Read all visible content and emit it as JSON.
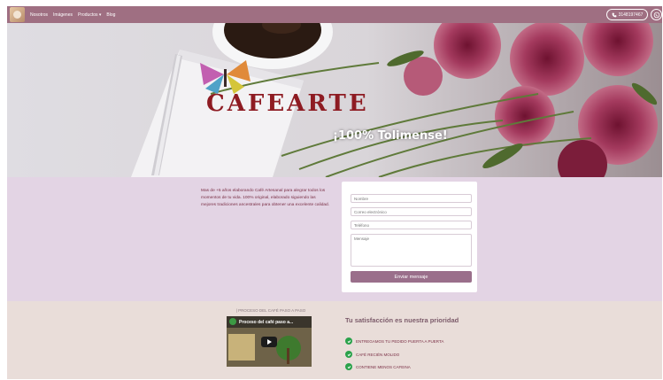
{
  "nav": {
    "links": [
      "Nosotros",
      "Imágenes",
      "Productos",
      "Blog"
    ],
    "products_caret": "▾",
    "phone": "3148197467"
  },
  "hero": {
    "brand": "CAFEARTE",
    "tagline": "¡100% Tolimense!"
  },
  "intro": {
    "text": "Mas de +5 años elaborando Café Artesanal para alegrar todos los momentos de tu vida. 100% original, elaborado siguiendo las mejores tradiciones ancestrales para obtener una excelente calidad."
  },
  "form": {
    "name_placeholder": "Nombre",
    "email_placeholder": "Correo electrónico",
    "phone_placeholder": "Teléfono",
    "message_placeholder": "Mensaje",
    "submit_label": "Enviar mensaje"
  },
  "video": {
    "heading": "| PROCESO DEL CAFÉ PASO A PASO",
    "caption": "Proceso del café paso a..."
  },
  "benefits": {
    "title": "Tu satisfacción es nuestra prioridad",
    "items": [
      "ENTREGAMOS TU PEDIDO PUERTA A PUERTA",
      "CAFÉ RECIÉN MOLIDO",
      "CONTIENE MENOS CAFEINA"
    ]
  },
  "colors": {
    "navbar": "#9f6f82",
    "contact_bg": "#e3d4e4",
    "bottom_bg": "#e9ddd9",
    "brand": "#8e1b22",
    "button": "#9a6f8b",
    "check": "#2aa24b"
  }
}
